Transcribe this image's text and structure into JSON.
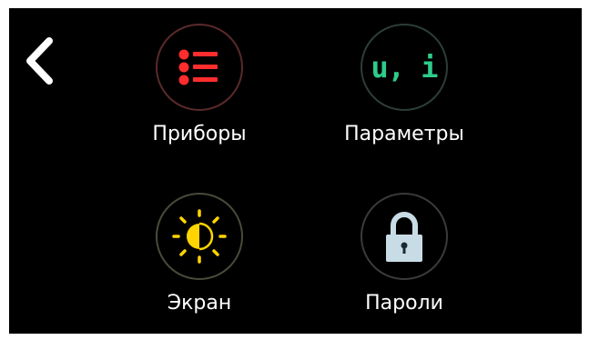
{
  "colors": {
    "background": "#000000",
    "text": "#ffffff",
    "devices_icon": "#ff2d2d",
    "parameters_icon": "#2ecc8a",
    "screen_icon": "#ffd400",
    "lock_icon": "#c8dce6"
  },
  "nav": {
    "back_icon": "chevron-left-icon"
  },
  "menu": {
    "items": [
      {
        "label": "Приборы",
        "icon": "list-icon"
      },
      {
        "label": "Параметры",
        "icon_text": "u, i",
        "icon": "parameters-icon"
      },
      {
        "label": "Экран",
        "icon": "brightness-icon"
      },
      {
        "label": "Пароли",
        "icon": "lock-icon"
      }
    ]
  }
}
